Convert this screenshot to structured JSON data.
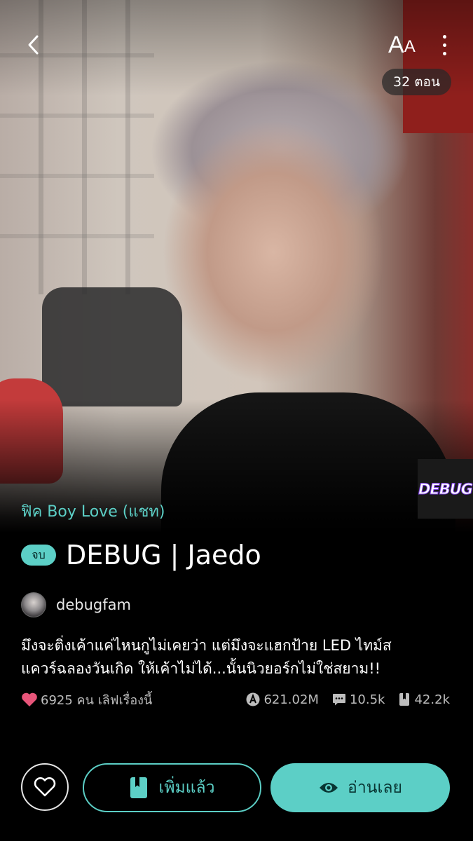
{
  "header": {
    "back_icon": "chevron-left-icon",
    "font_size_label_big": "A",
    "font_size_label_small": "A",
    "more_icon": "vertical-dots-icon",
    "episode_count": "32 ตอน"
  },
  "cover": {
    "watermark": "DEBUG"
  },
  "story": {
    "category": "ฟิค Boy Love (แชท)",
    "status_badge": "จบ",
    "title": "DEBUG | Jaedo",
    "author": "debugfam",
    "synopsis_line1": "มึงจะติ่งเค้าแค่ไหนกูไม่เคยว่า แต่มึงจะแฮกป้าย  LED ไทม์ส",
    "synopsis_line2": "แควร์ฉลองวันเกิด ให้เค้าไม่ได้...นั้นนิวยอร์กไม่ใช่สยาม!!"
  },
  "stats": {
    "likes": "6925 คน เลิฟเรื่องนี้",
    "views": "621.02M",
    "comments": "10.5k",
    "bookmarks": "42.2k"
  },
  "actions": {
    "like_icon": "heart-outline-icon",
    "library_label": "เพิ่มแล้ว",
    "library_icon": "bookmark-icon",
    "read_label": "อ่านเลย",
    "read_icon": "eye-icon"
  },
  "colors": {
    "accent": "#5ccfc6",
    "heart": "#e8557a",
    "background": "#000000"
  }
}
